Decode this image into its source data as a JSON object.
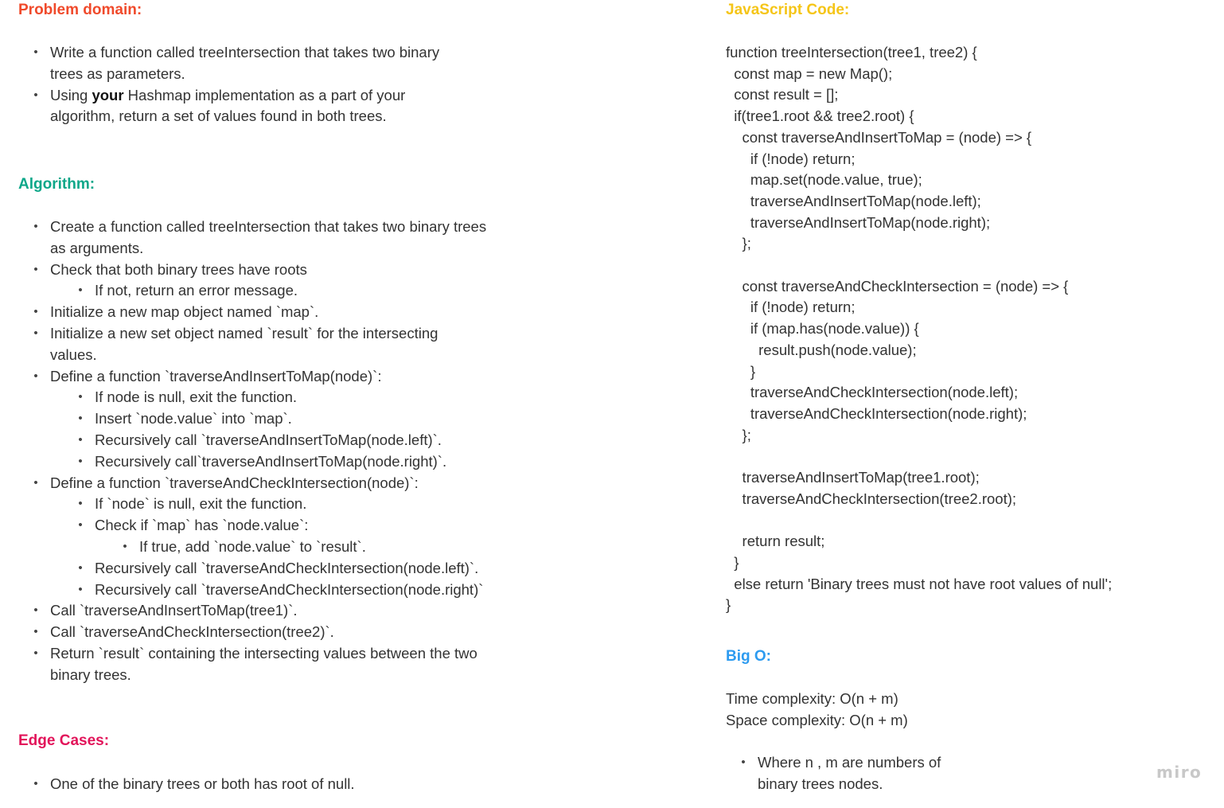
{
  "problem_domain": {
    "heading": "Problem domain:",
    "color": "#f04a2b",
    "items": [
      {
        "line1": "Write a function called treeIntersection that takes two binary",
        "line2": "trees as parameters."
      },
      {
        "pre": "Using ",
        "bold": "your",
        "post": " Hashmap implementation as a part of your",
        "line2": "algorithm, return a set of values found in both trees."
      }
    ]
  },
  "algorithm": {
    "heading": "Algorithm:",
    "color": "#0ca789",
    "lines": [
      "Create a function called treeIntersection that takes two binary trees",
      "as arguments.",
      "Check that both binary trees have roots",
      "If not, return an error message.",
      "Initialize a new map object named `map`.",
      "Initialize a new set object named `result` for the intersecting",
      "values.",
      "Define a function `traverseAndInsertToMap(node)`:",
      "If node is null, exit the function.",
      "Insert `node.value` into `map`.",
      "Recursively call `traverseAndInsertToMap(node.left)`.",
      "Recursively call`traverseAndInsertToMap(node.right)`.",
      "Define a function `traverseAndCheckIntersection(node)`:",
      "If `node` is null, exit the function.",
      "Check if `map` has `node.value`:",
      "If true, add `node.value` to `result`.",
      "Recursively call `traverseAndCheckIntersection(node.left)`.",
      "Recursively call `traverseAndCheckIntersection(node.right)`",
      "Call `traverseAndInsertToMap(tree1)`.",
      "Call `traverseAndCheckIntersection(tree2)`.",
      "Return `result` containing the intersecting values between the two",
      "binary trees."
    ]
  },
  "edge_cases": {
    "heading": "Edge Cases:",
    "color": "#e2145a",
    "items": [
      "One of the binary trees or both has root of null."
    ]
  },
  "javascript": {
    "heading": "JavaScript Code:",
    "color": "#f5c518",
    "code": "function treeIntersection(tree1, tree2) {\n  const map = new Map();\n  const result = [];\n  if(tree1.root && tree2.root) {\n    const traverseAndInsertToMap = (node) => {\n      if (!node) return;\n      map.set(node.value, true);\n      traverseAndInsertToMap(node.left);\n      traverseAndInsertToMap(node.right);\n    };\n\n    const traverseAndCheckIntersection = (node) => {\n      if (!node) return;\n      if (map.has(node.value)) {\n        result.push(node.value);\n      }\n      traverseAndCheckIntersection(node.left);\n      traverseAndCheckIntersection(node.right);\n    };\n\n    traverseAndInsertToMap(tree1.root);\n    traverseAndCheckIntersection(tree2.root);\n\n    return result;\n  }\n  else return 'Binary trees must not have root values of null';\n}"
  },
  "big_o": {
    "heading": "Big O:",
    "color": "#2d9bf0",
    "time": "Time complexity: O(n + m)",
    "space": "Space complexity: O(n + m)",
    "note_line1": "Where n , m are numbers of",
    "note_line2": "binary trees nodes."
  },
  "watermark": "miro"
}
